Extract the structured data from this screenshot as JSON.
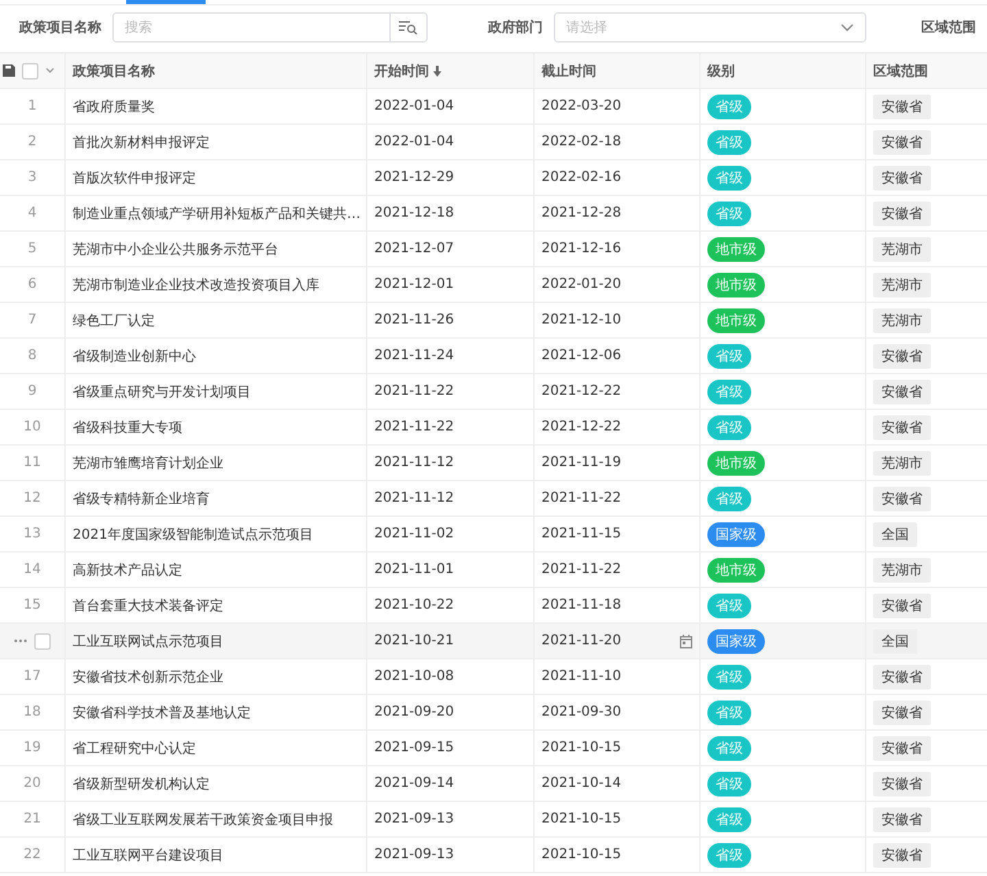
{
  "filters": [
    {
      "kind": "search",
      "label": "政策项目名称",
      "placeholder": "搜索"
    },
    {
      "kind": "select",
      "label": "政府部门",
      "placeholder": "请选择"
    },
    {
      "kind": "label",
      "label": "区域范围"
    }
  ],
  "table": {
    "select_all": {
      "checked": false
    },
    "columns": [
      {
        "label": "政策项目名称",
        "sorted": false
      },
      {
        "label": "开始时间",
        "sorted": true
      },
      {
        "label": "截止时间",
        "sorted": false
      },
      {
        "label": "级别",
        "sorted": false
      },
      {
        "label": "区域范围",
        "sorted": false
      }
    ],
    "rows": [
      {
        "index": "1",
        "hovered": false,
        "name": "省政府质量奖",
        "start": "2022-01-04",
        "end": "2022-03-20",
        "level": {
          "text": "省级",
          "color": "#19c5c5"
        },
        "region": "安徽省"
      },
      {
        "index": "2",
        "hovered": false,
        "name": "首批次新材料申报评定",
        "start": "2022-01-04",
        "end": "2022-02-18",
        "level": {
          "text": "省级",
          "color": "#19c5c5"
        },
        "region": "安徽省"
      },
      {
        "index": "3",
        "hovered": false,
        "name": "首版次软件申报评定",
        "start": "2021-12-29",
        "end": "2022-02-16",
        "level": {
          "text": "省级",
          "color": "#19c5c5"
        },
        "region": "安徽省"
      },
      {
        "index": "4",
        "hovered": false,
        "name": "制造业重点领域产学研用补短板产品和关键共…",
        "start": "2021-12-18",
        "end": "2021-12-28",
        "level": {
          "text": "省级",
          "color": "#19c5c5"
        },
        "region": "安徽省"
      },
      {
        "index": "5",
        "hovered": false,
        "name": "芜湖市中小企业公共服务示范平台",
        "start": "2021-12-07",
        "end": "2021-12-16",
        "level": {
          "text": "地市级",
          "color": "#1ec25a"
        },
        "region": "芜湖市"
      },
      {
        "index": "6",
        "hovered": false,
        "name": "芜湖市制造业企业技术改造投资项目入库",
        "start": "2021-12-01",
        "end": "2022-01-20",
        "level": {
          "text": "地市级",
          "color": "#1ec25a"
        },
        "region": "芜湖市"
      },
      {
        "index": "7",
        "hovered": false,
        "name": "绿色工厂认定",
        "start": "2021-11-26",
        "end": "2021-12-10",
        "level": {
          "text": "地市级",
          "color": "#1ec25a"
        },
        "region": "芜湖市"
      },
      {
        "index": "8",
        "hovered": false,
        "name": "省级制造业创新中心",
        "start": "2021-11-24",
        "end": "2021-12-06",
        "level": {
          "text": "省级",
          "color": "#19c5c5"
        },
        "region": "安徽省"
      },
      {
        "index": "9",
        "hovered": false,
        "name": "省级重点研究与开发计划项目",
        "start": "2021-11-22",
        "end": "2021-12-22",
        "level": {
          "text": "省级",
          "color": "#19c5c5"
        },
        "region": "安徽省"
      },
      {
        "index": "10",
        "hovered": false,
        "name": "省级科技重大专项",
        "start": "2021-11-22",
        "end": "2021-12-22",
        "level": {
          "text": "省级",
          "color": "#19c5c5"
        },
        "region": "安徽省"
      },
      {
        "index": "11",
        "hovered": false,
        "name": "芜湖市雏鹰培育计划企业",
        "start": "2021-11-12",
        "end": "2021-11-19",
        "level": {
          "text": "地市级",
          "color": "#1ec25a"
        },
        "region": "芜湖市"
      },
      {
        "index": "12",
        "hovered": false,
        "name": "省级专精特新企业培育",
        "start": "2021-11-12",
        "end": "2021-11-22",
        "level": {
          "text": "省级",
          "color": "#19c5c5"
        },
        "region": "安徽省"
      },
      {
        "index": "13",
        "hovered": false,
        "name": "2021年度国家级智能制造试点示范项目",
        "start": "2021-11-02",
        "end": "2021-11-15",
        "level": {
          "text": "国家级",
          "color": "#2d8cf0"
        },
        "region": "全国"
      },
      {
        "index": "14",
        "hovered": false,
        "name": "高新技术产品认定",
        "start": "2021-11-01",
        "end": "2021-11-22",
        "level": {
          "text": "地市级",
          "color": "#1ec25a"
        },
        "region": "芜湖市"
      },
      {
        "index": "15",
        "hovered": false,
        "name": "首台套重大技术装备评定",
        "start": "2021-10-22",
        "end": "2021-11-18",
        "level": {
          "text": "省级",
          "color": "#19c5c5"
        },
        "region": "安徽省"
      },
      {
        "hovered": true,
        "checked": false,
        "name": "工业互联网试点示范项目",
        "start": "2021-10-21",
        "end": "2021-11-20",
        "level": {
          "text": "国家级",
          "color": "#2d8cf0"
        },
        "region": "全国"
      },
      {
        "index": "17",
        "hovered": false,
        "name": "安徽省技术创新示范企业",
        "start": "2021-10-08",
        "end": "2021-11-10",
        "level": {
          "text": "省级",
          "color": "#19c5c5"
        },
        "region": "安徽省"
      },
      {
        "index": "18",
        "hovered": false,
        "name": "安徽省科学技术普及基地认定",
        "start": "2021-09-20",
        "end": "2021-09-30",
        "level": {
          "text": "省级",
          "color": "#19c5c5"
        },
        "region": "安徽省"
      },
      {
        "index": "19",
        "hovered": false,
        "name": "省工程研究中心认定",
        "start": "2021-09-15",
        "end": "2021-10-15",
        "level": {
          "text": "省级",
          "color": "#19c5c5"
        },
        "region": "安徽省"
      },
      {
        "index": "20",
        "hovered": false,
        "name": "省级新型研发机构认定",
        "start": "2021-09-14",
        "end": "2021-10-14",
        "level": {
          "text": "省级",
          "color": "#19c5c5"
        },
        "region": "安徽省"
      },
      {
        "index": "21",
        "hovered": false,
        "name": "省级工业互联网发展若干政策资金项目申报",
        "start": "2021-09-13",
        "end": "2021-10-15",
        "level": {
          "text": "省级",
          "color": "#19c5c5"
        },
        "region": "安徽省"
      },
      {
        "index": "22",
        "hovered": false,
        "name": "工业互联网平台建设项目",
        "start": "2021-09-13",
        "end": "2021-10-15",
        "level": {
          "text": "省级",
          "color": "#19c5c5"
        },
        "region": "安徽省"
      }
    ]
  }
}
